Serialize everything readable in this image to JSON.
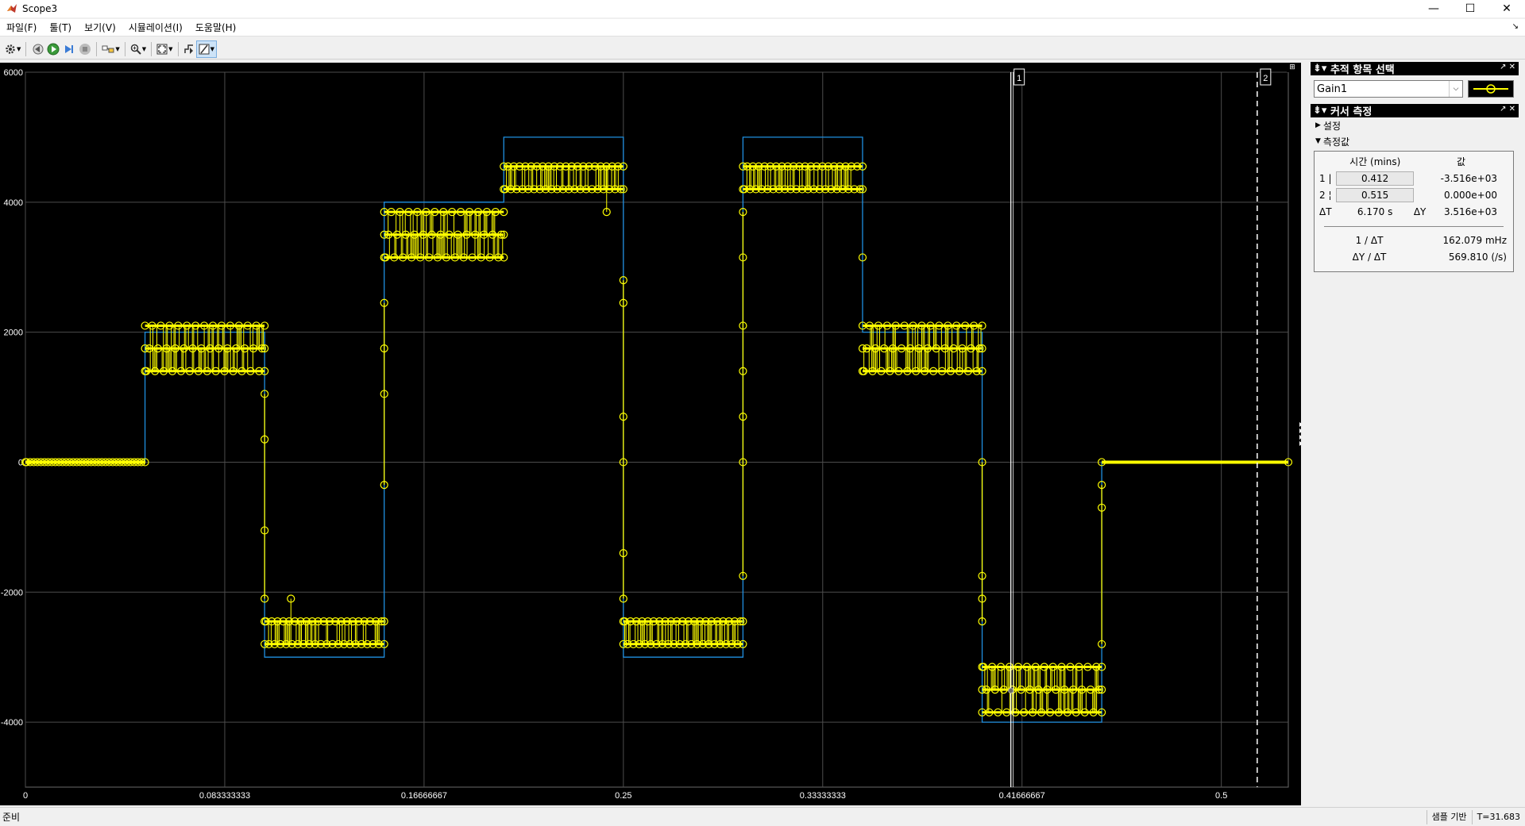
{
  "window": {
    "title": "Scope3",
    "controls": [
      "—",
      "☐",
      "✕"
    ]
  },
  "menu": {
    "items": [
      "파일(F)",
      "툴(T)",
      "보기(V)",
      "시뮬레이션(I)",
      "도움말(H)"
    ],
    "dock_arrow": "↘"
  },
  "toolbar": {
    "icons": [
      "gear-icon",
      "step-back-icon",
      "run-icon",
      "step-forward-icon",
      "stop-icon",
      "highlight-block-icon",
      "zoom-in-icon",
      "autoscale-icon",
      "triggers-icon",
      "cursor-measurements-icon"
    ]
  },
  "colors": {
    "plot_bg": "#000000",
    "grid": "#4d4d4d",
    "signal_yellow": "#ffff00",
    "signal_blue": "#1f8fe0",
    "axis_text": "#ffffff"
  },
  "axes": {
    "y_ticks": [
      "6000",
      "4000",
      "2000",
      "0",
      "-2000",
      "-4000"
    ],
    "x_ticks": [
      "0",
      "0.083333333",
      "0.16666667",
      "0.25",
      "0.33333333",
      "0.41666667",
      "0.5"
    ]
  },
  "cursors": {
    "c1_label": "1",
    "c2_label": "2",
    "c1_time": 0.412,
    "c2_time": 0.515
  },
  "chart_data": {
    "type": "line",
    "xlim": [
      0,
      0.528
    ],
    "ylim": [
      -5000,
      6000
    ],
    "grid": true,
    "series": [
      {
        "name": "Gain1",
        "style": "stairs",
        "x": [
          0,
          0.05,
          0.1,
          0.15,
          0.2,
          0.25,
          0.3,
          0.35,
          0.4,
          0.45,
          0.528
        ],
        "y": [
          0,
          2000,
          -3000,
          4000,
          5000,
          -3000,
          5000,
          2000,
          -4000,
          0,
          0
        ]
      },
      {
        "name": "Gain1 (sampled)",
        "style": "stem-circle",
        "bands": [
          {
            "x_range": [
              0,
              0.05
            ],
            "levels": [
              0
            ]
          },
          {
            "x_range": [
              0.05,
              0.1
            ],
            "levels": [
              1400,
              1750,
              2100
            ]
          },
          {
            "x_range": [
              0.1,
              0.15
            ],
            "levels": [
              -2450,
              -2800
            ]
          },
          {
            "x_range": [
              0.15,
              0.2
            ],
            "levels": [
              3150,
              3500,
              3850
            ]
          },
          {
            "x_range": [
              0.2,
              0.25
            ],
            "levels": [
              4200,
              4550
            ]
          },
          {
            "x_range": [
              0.25,
              0.3
            ],
            "levels": [
              -2450,
              -2800
            ]
          },
          {
            "x_range": [
              0.3,
              0.35
            ],
            "levels": [
              4200,
              4550
            ]
          },
          {
            "x_range": [
              0.35,
              0.4
            ],
            "levels": [
              1400,
              1750,
              2100
            ]
          },
          {
            "x_range": [
              0.4,
              0.45
            ],
            "levels": [
              -3150,
              -3500,
              -3850
            ]
          },
          {
            "x_range": [
              0.45,
              0.528
            ],
            "levels": [
              0
            ]
          }
        ],
        "transitions": [
          {
            "x": 0.1,
            "y": [
              1050,
              350,
              -1050,
              -2100
            ]
          },
          {
            "x": 0.15,
            "y": [
              -350,
              1050,
              1750,
              2450
            ]
          },
          {
            "x": 0.25,
            "y": [
              2800,
              2450,
              700,
              0,
              -1400,
              -2100
            ]
          },
          {
            "x": 0.3,
            "y": [
              -1750,
              0,
              700,
              1400,
              2100,
              3150,
              3850
            ]
          },
          {
            "x": 0.35,
            "y": [
              3150
            ]
          },
          {
            "x": 0.4,
            "y": [
              0,
              -1750,
              -2100,
              -2450
            ]
          },
          {
            "x": 0.45,
            "y": [
              -2800,
              -700,
              -350
            ]
          }
        ],
        "outliers": [
          {
            "x": 0.111,
            "y": -2100
          },
          {
            "x": 0.243,
            "y": 3850
          }
        ]
      }
    ]
  },
  "trace_panel": {
    "title": "추적 항목 선택",
    "selected": "Gain1",
    "controls": "↗ ✕"
  },
  "cursor_panel": {
    "title": "커서 측정",
    "controls": "↗ ✕",
    "settings_label": "설정",
    "measurements_label": "측정값",
    "col_time": "시간 (mins)",
    "col_value": "값",
    "rows": [
      {
        "idx": "1 |",
        "time": "0.412",
        "value": "-3.516e+03"
      },
      {
        "idx": "2 ¦",
        "time": "0.515",
        "value": "0.000e+00"
      }
    ],
    "dt_label": "ΔT",
    "dt_value": "6.170 s",
    "dy_label": "ΔY",
    "dy_value": "3.516e+03",
    "inv_dt_label": "1 / ΔT",
    "inv_dt_value": "162.079 mHz",
    "dydt_label": "ΔY / ΔT",
    "dydt_value": "569.810 (/s)"
  },
  "status": {
    "ready": "준비",
    "mode": "샘플 기반",
    "time": "T=31.683"
  }
}
